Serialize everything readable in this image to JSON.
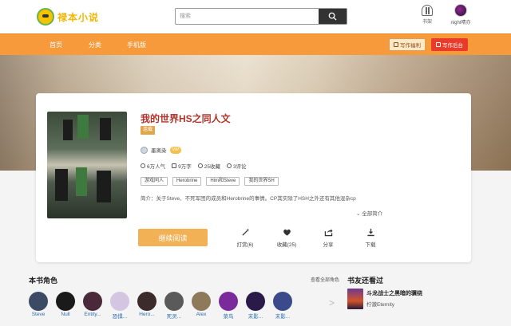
{
  "header": {
    "logo_text": "禄本小说",
    "search_placeholder": "搜索",
    "shelf_label": "书架",
    "username": "night晴亦"
  },
  "nav": {
    "items": [
      {
        "label": "首页"
      },
      {
        "label": "分类"
      },
      {
        "label": "手机版"
      }
    ],
    "welfare_button": "写作福利",
    "backend_button": "写作后台"
  },
  "book": {
    "title": "我的世界HS之同人文",
    "status": "连载",
    "author": "墨离染",
    "vip": "VIP",
    "stats": {
      "popularity": "6万人气",
      "words": "9万字",
      "favorites": "25收藏",
      "comments": "3评论"
    },
    "tags": [
      "游戏同人",
      "Herobrine",
      "Him和Steve",
      "我的世界SH"
    ],
    "intro": "简介：关于Steve、不死军团的成员和Herobrine的事情。CP其实除了HSH之外还有其他混杂cp",
    "expand_label": "全部简介",
    "read_button": "继续阅读",
    "actions": [
      {
        "label": "打赏(6)",
        "icon": "wand-icon"
      },
      {
        "label": "收藏(25)",
        "icon": "heart-icon"
      },
      {
        "label": "分享",
        "icon": "share-icon"
      },
      {
        "label": "下载",
        "icon": "download-icon"
      }
    ]
  },
  "roles": {
    "title": "本书角色",
    "more_label": "查看全部角色",
    "items": [
      {
        "name": "Steve",
        "color": "#3c4a66"
      },
      {
        "name": "Null",
        "color": "#1a1a1a"
      },
      {
        "name": "Entity...",
        "color": "#4a2a3a"
      },
      {
        "name": "恐惧...",
        "color": "#d4c6e3"
      },
      {
        "name": "Hero...",
        "color": "#3b2b2b"
      },
      {
        "name": "死灵...",
        "color": "#5a5a5a"
      },
      {
        "name": "Alex",
        "color": "#8e7a5a"
      },
      {
        "name": "菜鸟",
        "color": "#7a2a9a"
      },
      {
        "name": "末影...",
        "color": "#2a1a4a"
      },
      {
        "name": "末影...",
        "color": "#3a4a8a"
      }
    ]
  },
  "friends": {
    "title": "书友还看过",
    "book_title": "斗龙战士之黑暗的骥绕",
    "book_author": "柠澈Eternity"
  },
  "colors": {
    "nav_orange": "#f69a3b",
    "title_red": "#b0342a",
    "read_button": "#f2b155",
    "backend_red": "#e83b2a"
  }
}
